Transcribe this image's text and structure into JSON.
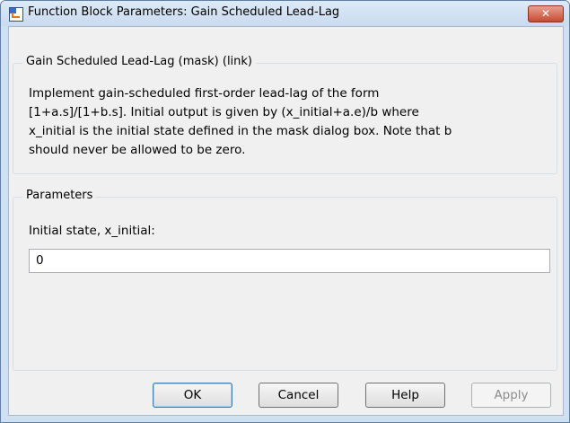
{
  "window": {
    "title": "Function Block Parameters: Gain Scheduled Lead-Lag",
    "close_label": "✕"
  },
  "mask": {
    "group_title": "Gain Scheduled Lead-Lag (mask) (link)",
    "description_lines": [
      "Implement gain-scheduled first-order lead-lag of the form",
      "[1+a.s]/[1+b.s]. Initial output is given by (x_initial+a.e)/b where",
      "x_initial is the initial state defined in the mask dialog box. Note that b",
      "should never be allowed to be zero."
    ]
  },
  "parameters": {
    "group_title": "Parameters",
    "initial_state_label": "Initial state, x_initial:",
    "initial_state_value": "0"
  },
  "buttons": {
    "ok": "OK",
    "cancel": "Cancel",
    "help": "Help",
    "apply": "Apply"
  }
}
